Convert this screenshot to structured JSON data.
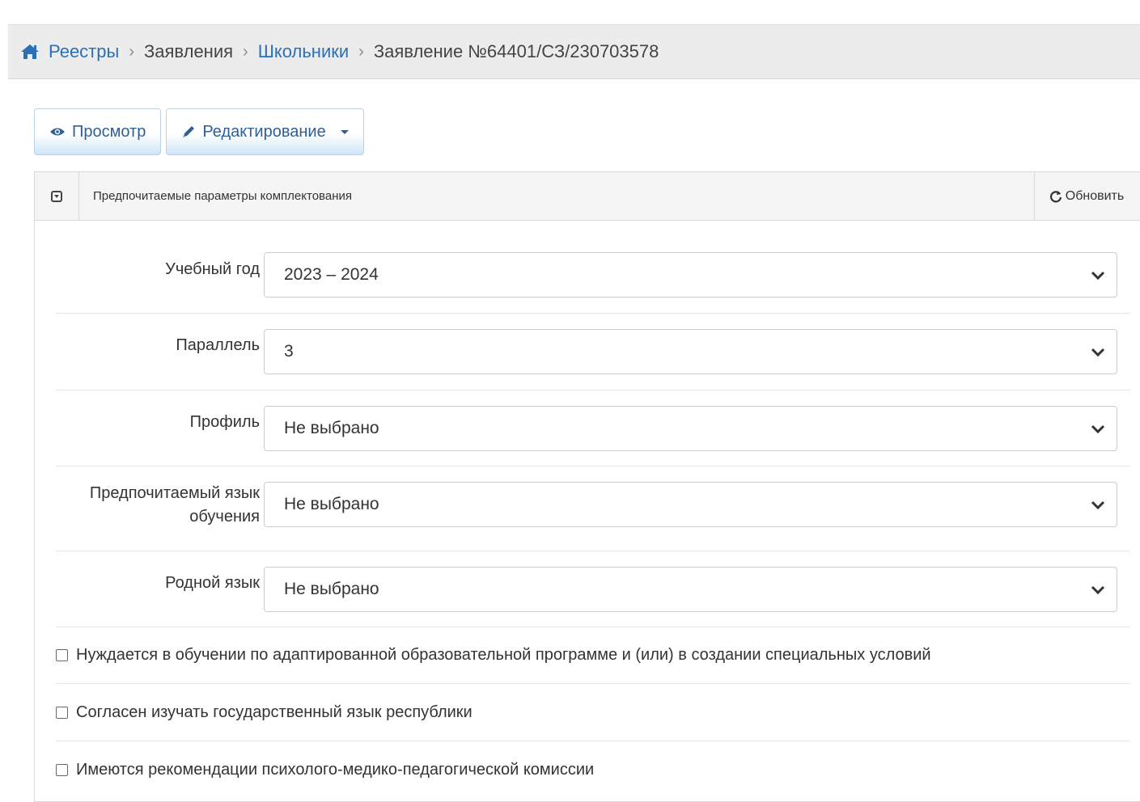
{
  "breadcrumb": {
    "items": [
      {
        "label": "Реестры"
      },
      {
        "label": "Заявления"
      },
      {
        "label": "Школьники"
      },
      {
        "label": "Заявление №64401/СЗ/230703578"
      }
    ]
  },
  "tabs": {
    "view_label": "Просмотр",
    "edit_label": "Редактирование"
  },
  "panel": {
    "title": "Предпочитаемые параметры комплектования",
    "refresh_label": "Обновить"
  },
  "fields": [
    {
      "label": "Учебный год",
      "value": "2023 – 2024"
    },
    {
      "label": "Параллель",
      "value": "3"
    },
    {
      "label": "Профиль",
      "value": "Не выбрано"
    },
    {
      "label": "Предпочитаемый язык обучения",
      "value": "Не выбрано"
    },
    {
      "label": "Родной язык",
      "value": "Не выбрано"
    }
  ],
  "checkboxes": [
    {
      "label": "Нуждается в обучении по адаптированной образовательной программе и (или) в создании специальных условий",
      "checked": false
    },
    {
      "label": "Согласен изучать государственный язык республики",
      "checked": false
    },
    {
      "label": "Имеются рекомендации психолого-медико-педагогической комиссии",
      "checked": false
    }
  ]
}
